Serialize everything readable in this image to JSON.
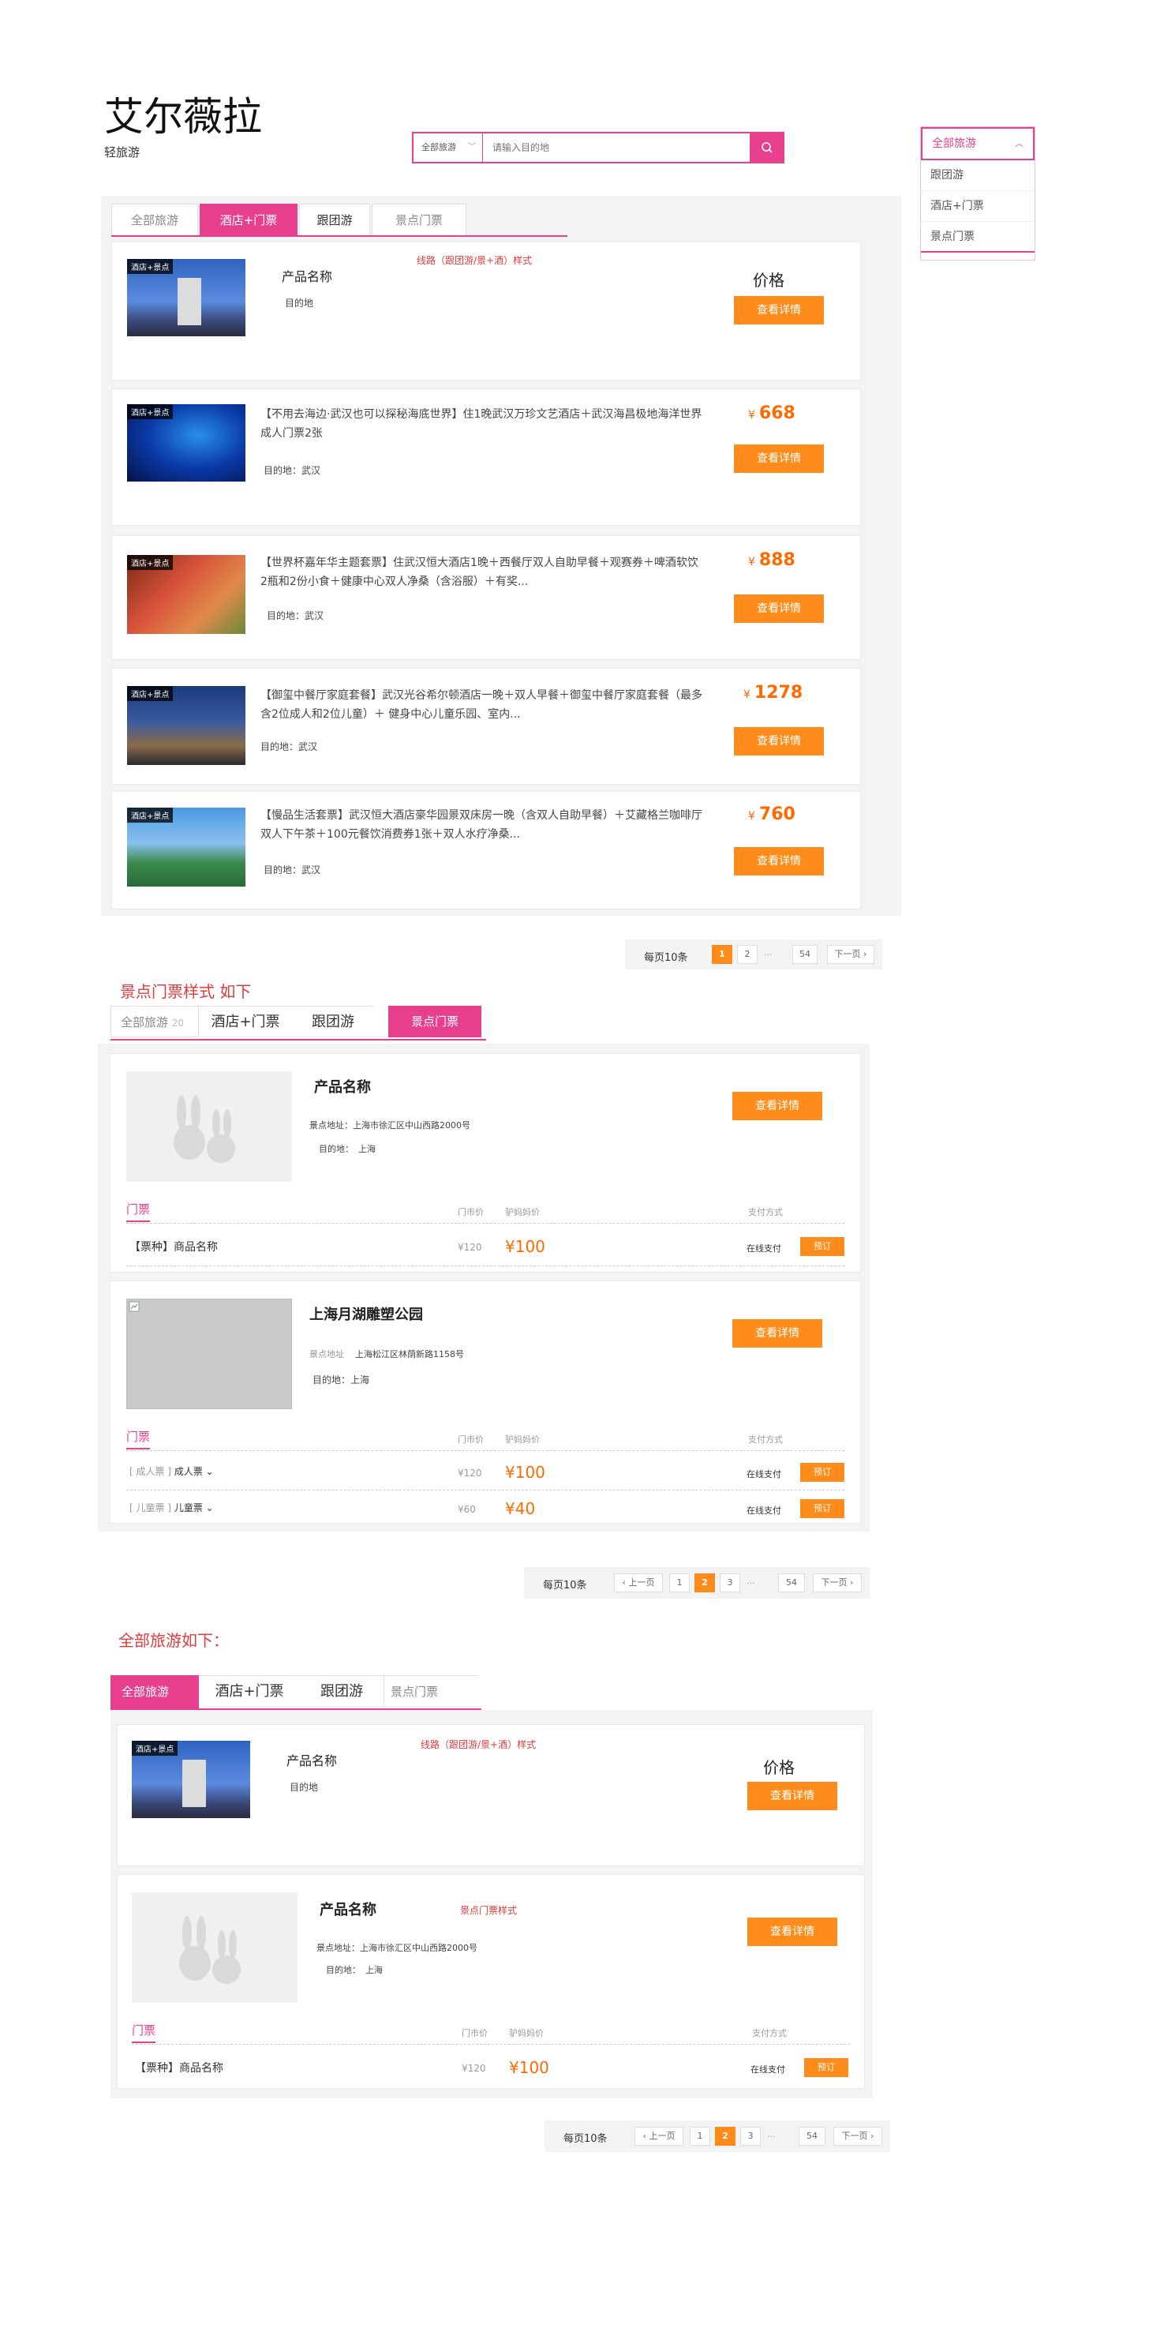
{
  "brand": {
    "title": "艾尔薇拉",
    "subtitle": "轻旅游"
  },
  "search": {
    "category": "全部旅游",
    "placeholder": "请输入目的地"
  },
  "dropdown": {
    "selected": "全部旅游",
    "items": [
      "跟团游",
      "酒店+门票",
      "景点门票"
    ]
  },
  "tabs1": [
    "全部旅游",
    "酒店+门票",
    "跟团游",
    "景点门票"
  ],
  "header1": {
    "name": "产品名称",
    "dest": "目的地",
    "note": "线路（跟团游/景+酒）样式",
    "price": "价格",
    "btn": "查看详情",
    "badge": "酒店+景点"
  },
  "list": [
    {
      "title": "【不用去海边·武汉也可以探秘海底世界】住1晚武汉万珍文艺酒店＋武汉海昌极地海洋世界成人门票2张",
      "dest": "目的地：武汉",
      "price": "668"
    },
    {
      "title": "【世界杯嘉年华主题套票】住武汉恒大酒店1晚＋西餐厅双人自助早餐＋观赛券＋啤酒软饮2瓶和2份小食＋健康中心双人净桑（含浴服）＋有奖...",
      "dest": "目的地：武汉",
      "price": "888"
    },
    {
      "title": "【御玺中餐厅家庭套餐】武汉光谷希尔顿酒店一晚＋双人早餐＋御玺中餐厅家庭套餐（最多含2位成人和2位儿童）＋ 健身中心儿童乐园、室内...",
      "dest": "目的地：武汉",
      "price": "1278"
    },
    {
      "title": "【慢品生活套票】武汉恒大酒店豪华园景双床房一晚（含双人自助早餐）＋艾藏格兰咖啡厅双人下午茶＋100元餐饮消费券1张＋双人水疗净桑...",
      "dest": "目的地：武汉",
      "price": "760"
    }
  ],
  "btn_detail": "查看详情",
  "yen": "¥",
  "pager1": {
    "per": "每页10条",
    "pages": [
      "1",
      "2",
      "...",
      "54",
      "下一页"
    ]
  },
  "sec2": {
    "heading": "景点门票样式 如下",
    "tabs": [
      "全部旅游",
      "酒店+门票",
      "跟团游",
      "景点门票"
    ],
    "count": "20"
  },
  "ticket1": {
    "name": "产品名称",
    "addr": "景点地址：上海市徐汇区中山西路2000号",
    "dest": "目的地：",
    "dest_city": "上海",
    "tab": "门票",
    "col_price": "门市价",
    "col_sale": "驴妈妈价",
    "col_pay": "支付方式",
    "row": "【票种】商品名称",
    "mprice": "¥120",
    "sale": "¥100",
    "pay": "在线支付",
    "book": "预订"
  },
  "ticket2": {
    "name": "上海月湖雕塑公园",
    "addr_l": "景点地址",
    "addr": "上海松江区林荫新路1158号",
    "dest": "目的地：上海",
    "tab": "门票",
    "col_price": "门市价",
    "col_sale": "驴妈妈价",
    "col_pay": "支付方式",
    "rows": [
      {
        "cat": "[ 成人票 ]",
        "name": "成人票",
        "mprice": "¥120",
        "sale": "¥100",
        "pay": "在线支付",
        "book": "预订"
      },
      {
        "cat": "[ 儿童票 ]",
        "name": "儿童票",
        "mprice": "¥60",
        "sale": "¥40",
        "pay": "在线支付",
        "book": "预订"
      }
    ]
  },
  "pager2": {
    "per": "每页10条",
    "prev": "上一页",
    "pages": [
      "1",
      "2",
      "3",
      "...",
      "54"
    ],
    "next": "下一页"
  },
  "sec3": {
    "heading": "全部旅游如下：",
    "tabs": [
      "全部旅游",
      "酒店+门票",
      "跟团游",
      "景点门票"
    ],
    "note2": "景点门票样式"
  },
  "pager3": {
    "per": "每页10条",
    "prev": "上一页",
    "pages": [
      "1",
      "2",
      "3",
      "...",
      "54"
    ],
    "next": "下一页"
  }
}
